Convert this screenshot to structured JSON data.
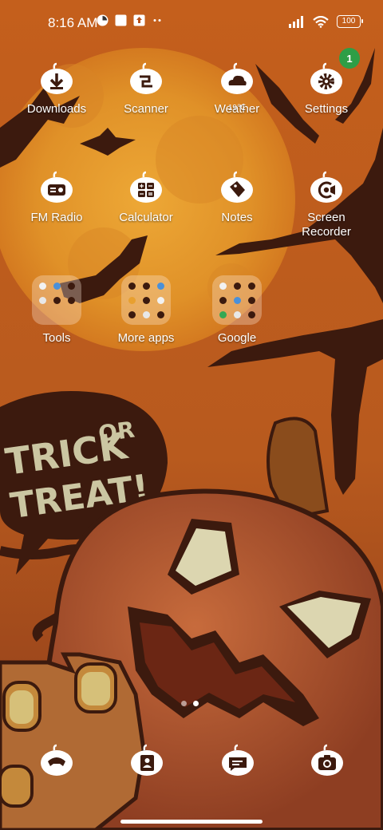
{
  "status_bar": {
    "time": "8:16 AM",
    "battery": "100",
    "icons": [
      "app-notification-icon",
      "white-square-icon",
      "upload-icon",
      "more-dots-icon",
      "signal-icon",
      "wifi-icon",
      "battery-icon"
    ]
  },
  "apps": [
    {
      "name": "downloads",
      "label": "Downloads",
      "icon": "download-icon"
    },
    {
      "name": "scanner",
      "label": "Scanner",
      "icon": "scanner-icon"
    },
    {
      "name": "weather",
      "label": "Weather",
      "icon": "cloud-icon",
      "temp": "19℃"
    },
    {
      "name": "settings",
      "label": "Settings",
      "icon": "gear-icon",
      "badge": "1"
    },
    {
      "name": "fm-radio",
      "label": "FM Radio",
      "icon": "radio-icon"
    },
    {
      "name": "calculator",
      "label": "Calculator",
      "icon": "calculator-icon"
    },
    {
      "name": "notes",
      "label": "Notes",
      "icon": "notes-icon"
    },
    {
      "name": "screen-recorder",
      "label": "Screen\nRecorder",
      "icon": "screen-recorder-icon"
    }
  ],
  "folders": [
    {
      "name": "tools",
      "label": "Tools"
    },
    {
      "name": "more-apps",
      "label": "More apps"
    },
    {
      "name": "google",
      "label": "Google"
    }
  ],
  "dock": [
    {
      "name": "phone",
      "icon": "phone-icon"
    },
    {
      "name": "contacts",
      "icon": "contacts-icon"
    },
    {
      "name": "messages",
      "icon": "messages-icon"
    },
    {
      "name": "camera",
      "icon": "camera-icon"
    }
  ],
  "wallpaper": {
    "text_line1": "TRICK",
    "text_line1b": "OR",
    "text_line2": "TREAT!",
    "colors": {
      "sky": "#c2611d",
      "moon": "#e39a2b",
      "dark": "#3c1a0e",
      "pumpkin": "#a7532f",
      "text": "#cbc6a2"
    }
  },
  "pager": {
    "pages": 2,
    "active": 2
  }
}
